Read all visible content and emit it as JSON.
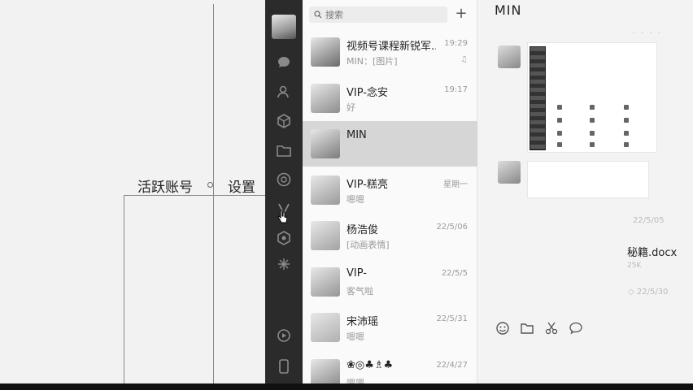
{
  "board": {
    "label_active_accounts": "活跃账号",
    "label_settings": "设置"
  },
  "sidebar": {
    "icons": [
      "chat-icon",
      "contacts-icon",
      "favorites-icon",
      "files-icon",
      "moments-icon",
      "channels-icon",
      "miniprogram-icon",
      "search-discover-icon",
      "phone-icon",
      "more-icon"
    ]
  },
  "search": {
    "placeholder": "搜索",
    "add_label": "+"
  },
  "chats": [
    {
      "name": "视频号课程新锐军...",
      "time": "19:29",
      "preview": "MIN：[图片]",
      "mark": "♫",
      "avatar": "#6a6a6a",
      "active": false
    },
    {
      "name": "VIP-念安",
      "time": "19:17",
      "preview": "好",
      "mark": "",
      "avatar": "#8d8d8d",
      "active": false
    },
    {
      "name": "MIN",
      "time": "",
      "preview": "",
      "mark": "",
      "avatar": "#7c7c7c",
      "active": true
    },
    {
      "name": "VIP-糕亮",
      "time": "星期一",
      "preview": "嗯嗯",
      "mark": "",
      "avatar": "#9a9a9a",
      "active": false
    },
    {
      "name": "杨浩俊",
      "time": "22/5/06",
      "preview": "[动画表情]",
      "mark": "",
      "avatar": "#a3a3a3",
      "active": false
    },
    {
      "name": "VIP-",
      "time": "22/5/5",
      "preview": "客气啦",
      "mark": "",
      "avatar": "#959595",
      "active": false
    },
    {
      "name": "宋沛瑶",
      "time": "22/5/31",
      "preview": "嗯嗯",
      "mark": "",
      "avatar": "#b0b0b0",
      "active": false
    },
    {
      "name": "❀◎♣♗♣",
      "time": "22/4/27",
      "preview": "嗯嗯",
      "mark": "",
      "avatar": "#858585",
      "active": false
    }
  ],
  "conversation": {
    "title": "MIN",
    "timestamp_1": "22/5/05",
    "file_name": "秘籍.docx",
    "file_size": "25K",
    "timestamp_2": "◇ 22/5/30",
    "toolbar": [
      "emoji-icon",
      "folder-icon",
      "scissors-icon",
      "chat-bubble-icon"
    ]
  }
}
